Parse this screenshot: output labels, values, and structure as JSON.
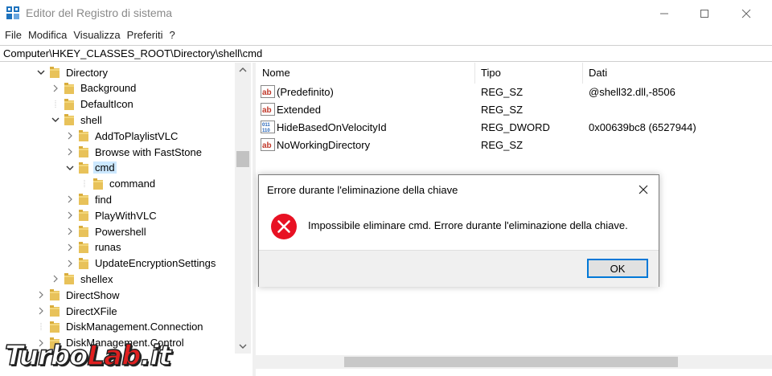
{
  "window": {
    "title": "Editor del Registro di sistema"
  },
  "menu": [
    "File",
    "Modifica",
    "Visualizza",
    "Preferiti",
    "?"
  ],
  "address": "Computer\\HKEY_CLASSES_ROOT\\Directory\\shell\\cmd",
  "tree": [
    {
      "label": "Directory",
      "depth": 0,
      "expander": "open"
    },
    {
      "label": "Background",
      "depth": 1,
      "expander": "closed"
    },
    {
      "label": "DefaultIcon",
      "depth": 1,
      "expander": "none"
    },
    {
      "label": "shell",
      "depth": 1,
      "expander": "open"
    },
    {
      "label": "AddToPlaylistVLC",
      "depth": 2,
      "expander": "closed"
    },
    {
      "label": "Browse with FastStone",
      "depth": 2,
      "expander": "closed"
    },
    {
      "label": "cmd",
      "depth": 2,
      "expander": "open",
      "selected": true
    },
    {
      "label": "command",
      "depth": 3,
      "expander": "none"
    },
    {
      "label": "find",
      "depth": 2,
      "expander": "closed"
    },
    {
      "label": "PlayWithVLC",
      "depth": 2,
      "expander": "closed"
    },
    {
      "label": "Powershell",
      "depth": 2,
      "expander": "closed"
    },
    {
      "label": "runas",
      "depth": 2,
      "expander": "closed"
    },
    {
      "label": "UpdateEncryptionSettings",
      "depth": 2,
      "expander": "closed"
    },
    {
      "label": "shellex",
      "depth": 1,
      "expander": "closed"
    },
    {
      "label": "DirectShow",
      "depth": 0,
      "expander": "closed"
    },
    {
      "label": "DirectXFile",
      "depth": 0,
      "expander": "closed"
    },
    {
      "label": "DiskManagement.Connection",
      "depth": 0,
      "expander": "none"
    },
    {
      "label": "DiskManagement.Control",
      "depth": 0,
      "expander": "closed"
    }
  ],
  "columns": {
    "name": "Nome",
    "type": "Tipo",
    "data": "Dati"
  },
  "values": [
    {
      "name": "(Predefinito)",
      "type": "REG_SZ",
      "data": "@shell32.dll,-8506",
      "icon": "string-value-icon"
    },
    {
      "name": "Extended",
      "type": "REG_SZ",
      "data": "",
      "icon": "string-value-icon"
    },
    {
      "name": "HideBasedOnVelocityId",
      "type": "REG_DWORD",
      "data": "0x00639bc8 (6527944)",
      "icon": "dword-value-icon"
    },
    {
      "name": "NoWorkingDirectory",
      "type": "REG_SZ",
      "data": "",
      "icon": "string-value-icon"
    }
  ],
  "dialog": {
    "title": "Errore durante l'eliminazione della chiave",
    "message": "Impossibile eliminare cmd. Errore durante l'eliminazione della chiave.",
    "ok_label": "OK",
    "icon": "error-icon"
  },
  "watermark": {
    "part1": "Turbo",
    "part2": "Lab",
    "part3": ".it"
  },
  "colors": {
    "selection": "#cce8ff",
    "accent": "#0078d7",
    "error": "#e81123"
  }
}
